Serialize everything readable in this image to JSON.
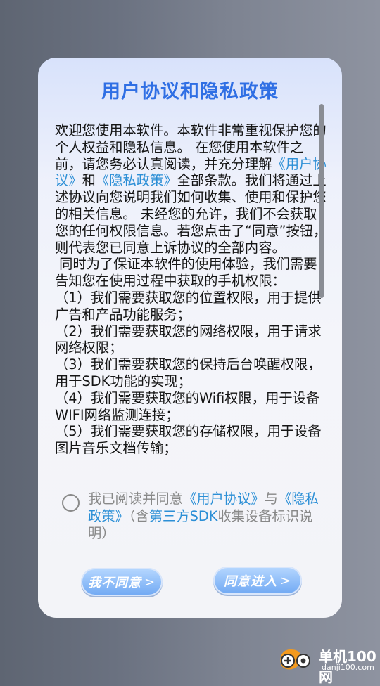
{
  "dialog": {
    "title": "用户协议和隐私政策",
    "body": {
      "p1_a": "欢迎您使用本软件。本软件非常重视保护您的个人权益和隐私信息。 在您使用本软件之前，请您务必认真阅读，并充分理解",
      "p1_link1": "《用户协议》",
      "p1_and": "和",
      "p1_link2": "《隐私政策》",
      "p1_b": "全部条款。我们将通过上述协议向您说明我们如何收集、使用和保护您的相关信息。 未经您的允许，我们不会获取您的任何权限信息。若您点击了“同意”按钮，则代表您已同意上诉协议的全部内容。",
      "p2": " 同时为了保证本软件的使用体验，我们需要告知您在使用过程中获取的手机权限：",
      "items": [
        "（1）我们需要获取您的位置权限，用于提供广告和产品功能服务；",
        "（2）我们需要获取您的网络权限，用于请求网络权限；",
        "（3）我们需要获取您的保持后台唤醒权限，用于SDK功能的实现；",
        "（4）我们需要获取您的Wifi权限，用于设备WIFI网络监测连接；",
        "（5）我们需要获取您的存储权限，用于设备图片音乐文档传输；"
      ]
    },
    "agree": {
      "prefix": "我已阅读并同意",
      "link1": "《用户协议》",
      "and": "与",
      "link2": "《隐私政策》",
      "mid": "（含",
      "link3": "第三方SDK",
      "suffix": "收集设备标识说明）"
    },
    "buttons": {
      "decline": "我不同意",
      "accept": "同意进入",
      "arrow": ">"
    }
  },
  "watermark": {
    "title": "单机100网",
    "subtitle": "danji100.com"
  },
  "colors": {
    "title": "#2f6fe4",
    "link": "#2c8fd6",
    "button_top": "#b7d8ff",
    "button_bottom": "#6fa8f3"
  }
}
